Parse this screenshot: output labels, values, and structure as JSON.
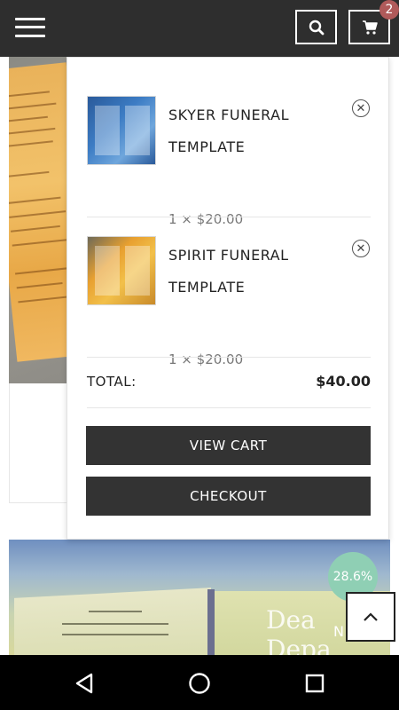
{
  "header": {
    "menu_icon": "hamburger-menu-icon",
    "search_icon": "search-icon",
    "cart_icon": "shopping-cart-icon",
    "cart_count": "2"
  },
  "cart": {
    "items": [
      {
        "title": "SKYER FUNERAL TEMPLATE",
        "quantity_price": "1 × $20.00",
        "remove_icon": "close-circle-icon"
      },
      {
        "title": "SPIRIT FUNERAL TEMPLATE",
        "quantity_price": "1 × $20.00",
        "remove_icon": "close-circle-icon"
      }
    ],
    "total_label": "TOTAL:",
    "total_value": "$40.00",
    "view_cart_label": "VIEW CART",
    "checkout_label": "CHECKOUT"
  },
  "background": {
    "discount_badge": "28.6%",
    "new_label": "N"
  },
  "scroll_top_icon": "chevron-up-icon",
  "navbar": {
    "back_icon": "back-triangle-icon",
    "home_icon": "home-circle-icon",
    "recents_icon": "recents-square-icon"
  },
  "colors": {
    "topbar": "#2e2e2e",
    "button_dark": "#333333",
    "badge": "#b05a5a",
    "discount": "#8fcfb4"
  }
}
